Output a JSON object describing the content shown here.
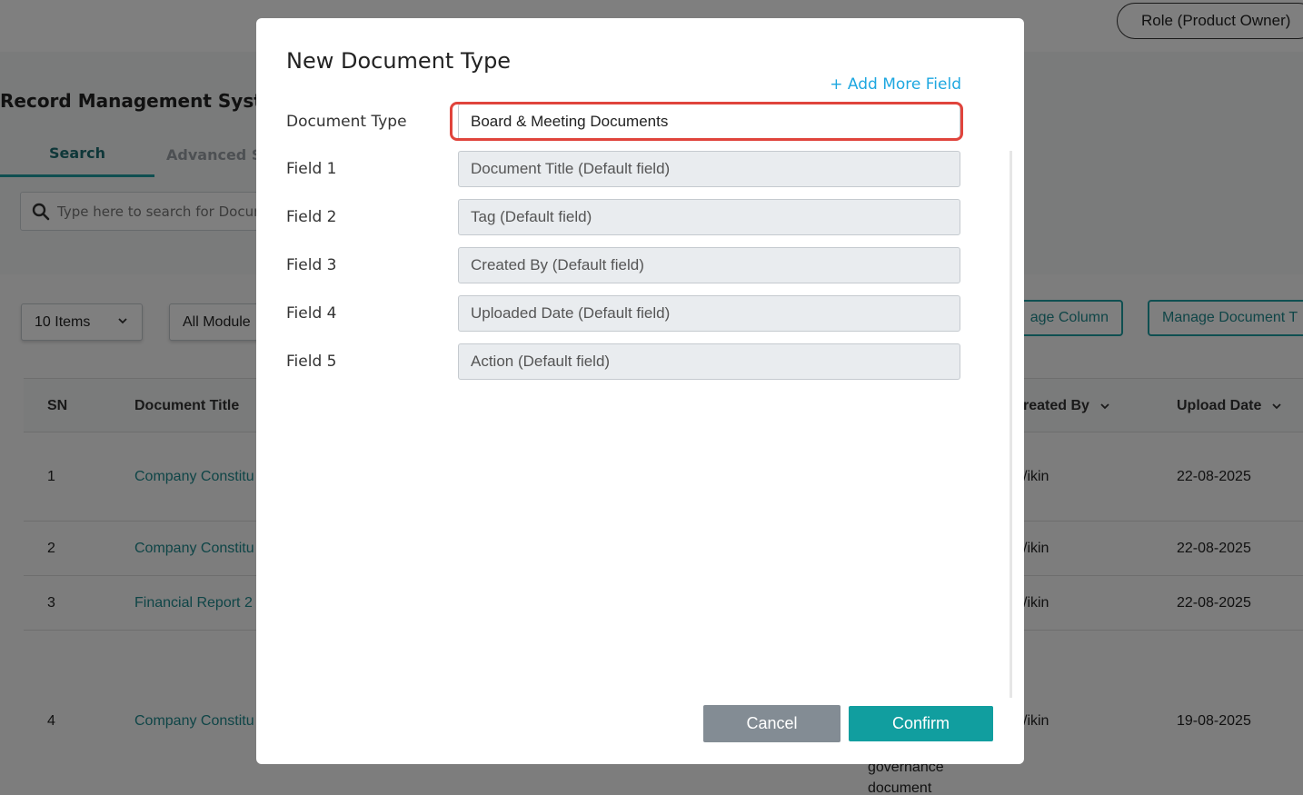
{
  "header": {
    "role_button": "Role (Product Owner)"
  },
  "page": {
    "title": "Record Management Syst",
    "tabs": [
      {
        "label": "Search"
      },
      {
        "label": "Advanced S"
      }
    ],
    "search_placeholder": "Type here to search for Docur",
    "items_select": "10 Items",
    "module_select": "All Module",
    "manage_column_button": "age Column",
    "manage_doctype_button": "Manage Document T"
  },
  "table": {
    "headers": {
      "sn": "SN",
      "title": "Document Title",
      "created_by": "reated By",
      "upload_date": "Upload Date"
    },
    "rows": [
      {
        "sn": "1",
        "title": "Company Constitu",
        "created_by": "/ikin",
        "date": "22-08-2025"
      },
      {
        "sn": "2",
        "title": "Company Constitu",
        "created_by": "/ikin",
        "date": "22-08-2025"
      },
      {
        "sn": "3",
        "title": "Financial Report 2",
        "created_by": "/ikin",
        "date": "22-08-2025"
      },
      {
        "sn": "4",
        "title": "Company Constitu",
        "created_by": "/ikin",
        "date": "19-08-2025"
      }
    ],
    "row4_extra": [
      "governance",
      "document"
    ]
  },
  "modal": {
    "title": "New Document Type",
    "add_more_field": "+ Add More Field",
    "document_type": {
      "label": "Document Type",
      "value": "Board & Meeting Documents"
    },
    "fields": [
      {
        "label": "Field 1",
        "value": "Document Title (Default field)"
      },
      {
        "label": "Field 2",
        "value": "Tag (Default field)"
      },
      {
        "label": "Field 3",
        "value": "Created By (Default field)"
      },
      {
        "label": "Field 4",
        "value": "Uploaded Date (Default field)"
      },
      {
        "label": "Field 5",
        "value": "Action (Default field)"
      }
    ],
    "cancel_label": "Cancel",
    "confirm_label": "Confirm"
  },
  "colors": {
    "accent": "#119e9f",
    "link": "#1ea7e0",
    "highlight": "#e0443c",
    "cancel": "#838c94"
  }
}
